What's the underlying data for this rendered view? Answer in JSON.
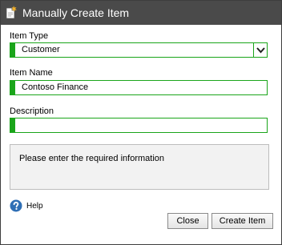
{
  "dialog": {
    "title": "Manually Create Item",
    "title_icon": "new-item-icon"
  },
  "form": {
    "item_type": {
      "label": "Item Type",
      "value": "Customer",
      "dropdown_icon": "chevron-down-icon"
    },
    "item_name": {
      "label": "Item Name",
      "value": "Contoso Finance"
    },
    "description": {
      "label": "Description",
      "value": ""
    }
  },
  "message": "Please enter the required information",
  "help": {
    "label": "Help",
    "icon": "question-mark-icon"
  },
  "buttons": {
    "close": "Close",
    "create": "Create Item"
  },
  "colors": {
    "title_bar": "#4a4a4a",
    "required_accent": "#1aa51a",
    "help_icon": "#2f6fb5"
  }
}
